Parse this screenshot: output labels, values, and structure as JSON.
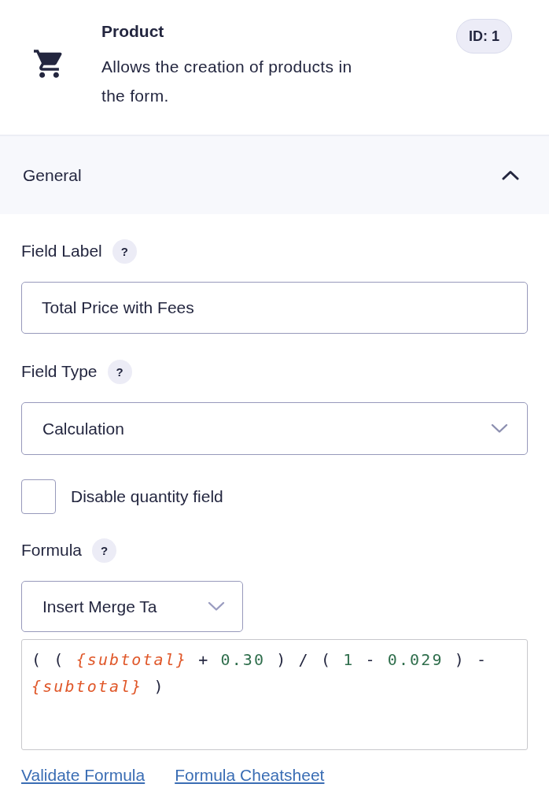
{
  "header": {
    "title": "Product",
    "description": "Allows the creation of products in the form.",
    "id_badge": "ID: 1"
  },
  "section": {
    "title": "General",
    "expanded": true
  },
  "fields": [
    {
      "kind": "text",
      "label": "Field Label",
      "help": "?",
      "value": "Total Price with Fees"
    },
    {
      "kind": "select",
      "label": "Field Type",
      "help": "?",
      "value": "Calculation"
    },
    {
      "kind": "checkbox",
      "label": "Disable quantity field",
      "checked": false
    },
    {
      "kind": "formula",
      "label": "Formula",
      "help": "?",
      "merge_button": "Insert Merge Ta",
      "tokens": [
        {
          "kind": "op",
          "text": "("
        },
        {
          "kind": "op",
          "text": "("
        },
        {
          "kind": "tag",
          "text": "{subtotal}"
        },
        {
          "kind": "op",
          "text": "+"
        },
        {
          "kind": "number",
          "text": "0.30"
        },
        {
          "kind": "op",
          "text": ")"
        },
        {
          "kind": "op",
          "text": "/"
        },
        {
          "kind": "op",
          "text": "("
        },
        {
          "kind": "number",
          "text": "1"
        },
        {
          "kind": "op",
          "text": "-"
        },
        {
          "kind": "number",
          "text": "0.029"
        },
        {
          "kind": "op",
          "text": ")"
        },
        {
          "kind": "op",
          "text": "-"
        },
        {
          "kind": "tag",
          "text": "{subtotal}"
        },
        {
          "kind": "op",
          "text": ")"
        }
      ]
    }
  ],
  "links": [
    "Validate Formula",
    "Formula Cheatsheet"
  ]
}
